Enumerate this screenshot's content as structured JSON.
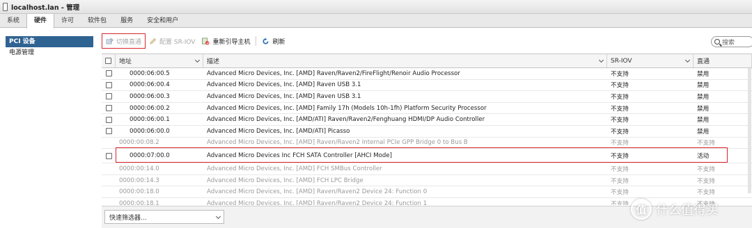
{
  "window": {
    "title": "localhost.lan - 管理"
  },
  "tabs": [
    "系统",
    "硬件",
    "许可",
    "软件包",
    "服务",
    "安全和用户"
  ],
  "active_tab": "硬件",
  "sidebar": {
    "items": [
      {
        "label": "PCI 设备",
        "active": true
      },
      {
        "label": "电源管理",
        "active": false
      }
    ]
  },
  "toolbar": {
    "toggle_passthrough": "切换直通",
    "configure_sriov": "配置 SR-IOV",
    "reboot_host": "重新引导主机",
    "refresh": "刷新"
  },
  "search": {
    "placeholder": "搜索"
  },
  "table": {
    "columns": {
      "address": "地址",
      "description": "描述",
      "sriov": "SR-IOV",
      "passthrough": "直通"
    },
    "rows": [
      {
        "address": "0000:06:00.5",
        "description": "Advanced Micro Devices, Inc. [AMD] Raven/Raven2/FireFlight/Renoir Audio Processor",
        "sriov": "不支持",
        "passthrough": "禁用",
        "dim": false
      },
      {
        "address": "0000:06:00.4",
        "description": "Advanced Micro Devices, Inc. [AMD] Raven USB 3.1",
        "sriov": "不支持",
        "passthrough": "禁用",
        "dim": false
      },
      {
        "address": "0000:06:00.3",
        "description": "Advanced Micro Devices, Inc. [AMD] Raven USB 3.1",
        "sriov": "不支持",
        "passthrough": "禁用",
        "dim": false
      },
      {
        "address": "0000:06:00.2",
        "description": "Advanced Micro Devices, Inc. [AMD] Family 17h (Models 10h-1fh) Platform Security Processor",
        "sriov": "不支持",
        "passthrough": "禁用",
        "dim": false
      },
      {
        "address": "0000:06:00.1",
        "description": "Advanced Micro Devices, Inc. [AMD/ATI] Raven/Raven2/Fenghuang HDMI/DP Audio Controller",
        "sriov": "不支持",
        "passthrough": "禁用",
        "dim": false
      },
      {
        "address": "0000:06:00.0",
        "description": "Advanced Micro Devices, Inc. [AMD/ATI] Picasso",
        "sriov": "不支持",
        "passthrough": "禁用",
        "dim": false
      },
      {
        "address": "0000:00:08.2",
        "description": "Advanced Micro Devices, Inc. [AMD] Raven/Raven2 Internal PCIe GPP Bridge 0 to Bus B",
        "sriov": "不支持",
        "passthrough": "不支持",
        "dim": true
      },
      {
        "address": "0000:07:00.0",
        "description": "Advanced Micro Devices Inc FCH SATA Controller [AHCI Mode]",
        "sriov": "不支持",
        "passthrough": "活动",
        "dim": false,
        "highlight": true
      },
      {
        "address": "0000:00:14.0",
        "description": "Advanced Micro Devices, Inc. [AMD] FCH SMBus Controller",
        "sriov": "不支持",
        "passthrough": "不支持",
        "dim": true
      },
      {
        "address": "0000:00:14.3",
        "description": "Advanced Micro Devices, Inc. [AMD] FCH LPC Bridge",
        "sriov": "不支持",
        "passthrough": "不支持",
        "dim": true
      },
      {
        "address": "0000:00:18.0",
        "description": "Advanced Micro Devices, Inc. [AMD] Raven/Raven2 Device 24: Function 0",
        "sriov": "不支持",
        "passthrough": "不支持",
        "dim": true
      },
      {
        "address": "0000:00:18.1",
        "description": "Advanced Micro Devices, Inc. [AMD] Raven/Raven2 Device 24: Function 1",
        "sriov": "不支持",
        "passthrough": "不支持",
        "dim": true
      }
    ]
  },
  "footer": {
    "quick_filter": "快速筛选器..."
  },
  "watermark": {
    "logo": "值",
    "text": "什么值得买"
  },
  "colors": {
    "accent": "#2f6392",
    "highlight": "#d9252b"
  }
}
